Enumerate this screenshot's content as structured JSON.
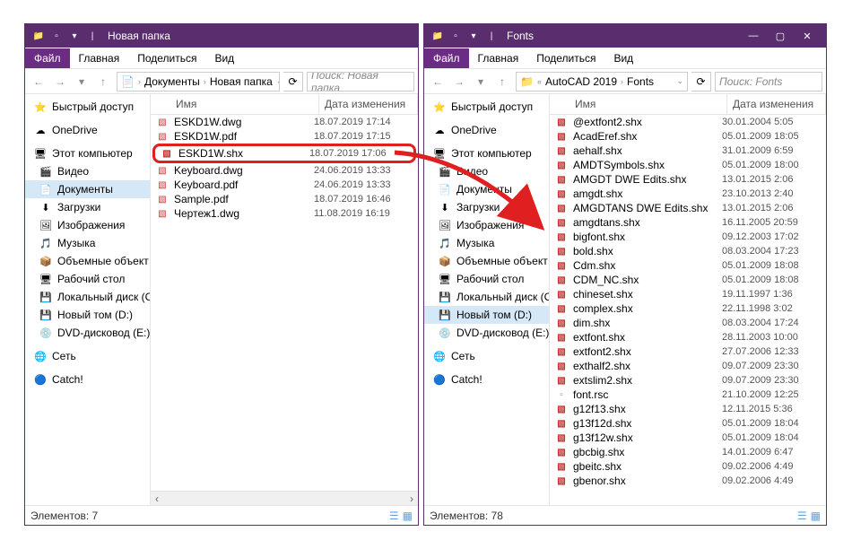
{
  "left": {
    "title": "Новая папка",
    "menu": {
      "file": "Файл",
      "home": "Главная",
      "share": "Поделиться",
      "view": "Вид"
    },
    "breadcrumb": [
      "Документы",
      "Новая папка"
    ],
    "search_placeholder": "Поиск: Новая папка",
    "columns": {
      "name": "Имя",
      "date": "Дата изменения"
    },
    "files": [
      {
        "name": "ESKD1W.dwg",
        "date": "18.07.2019 17:14",
        "icon": "dwg"
      },
      {
        "name": "ESKD1W.pdf",
        "date": "18.07.2019 17:15",
        "icon": "pdf"
      },
      {
        "name": "ESKD1W.shx",
        "date": "18.07.2019 17:06",
        "icon": "shx",
        "highlight": true
      },
      {
        "name": "Keyboard.dwg",
        "date": "24.06.2019 13:33",
        "icon": "dwg"
      },
      {
        "name": "Keyboard.pdf",
        "date": "24.06.2019 13:33",
        "icon": "pdf"
      },
      {
        "name": "Sample.pdf",
        "date": "18.07.2019 16:46",
        "icon": "pdf"
      },
      {
        "name": "Чертеж1.dwg",
        "date": "11.08.2019 16:19",
        "icon": "dwg"
      }
    ],
    "status": "Элементов: 7"
  },
  "right": {
    "title": "Fonts",
    "menu": {
      "file": "Файл",
      "home": "Главная",
      "share": "Поделиться",
      "view": "Вид"
    },
    "breadcrumb": [
      "AutoCAD 2019",
      "Fonts"
    ],
    "search_placeholder": "Поиск: Fonts",
    "columns": {
      "name": "Имя",
      "date": "Дата изменения"
    },
    "files": [
      {
        "name": "@extfont2.shx",
        "date": "30.01.2004 5:05",
        "icon": "shx"
      },
      {
        "name": "AcadEref.shx",
        "date": "05.01.2009 18:05",
        "icon": "shx"
      },
      {
        "name": "aehalf.shx",
        "date": "31.01.2009 6:59",
        "icon": "shx"
      },
      {
        "name": "AMDTSymbols.shx",
        "date": "05.01.2009 18:00",
        "icon": "shx"
      },
      {
        "name": "AMGDT DWE Edits.shx",
        "date": "13.01.2015 2:06",
        "icon": "shx"
      },
      {
        "name": "amgdt.shx",
        "date": "23.10.2013 2:40",
        "icon": "shx"
      },
      {
        "name": "AMGDTANS DWE Edits.shx",
        "date": "13.01.2015 2:06",
        "icon": "shx"
      },
      {
        "name": "amgdtans.shx",
        "date": "16.11.2005 20:59",
        "icon": "shx"
      },
      {
        "name": "bigfont.shx",
        "date": "09.12.2003 17:02",
        "icon": "shx"
      },
      {
        "name": "bold.shx",
        "date": "08.03.2004 17:23",
        "icon": "shx"
      },
      {
        "name": "Cdm.shx",
        "date": "05.01.2009 18:08",
        "icon": "shx"
      },
      {
        "name": "CDM_NC.shx",
        "date": "05.01.2009 18:08",
        "icon": "shx"
      },
      {
        "name": "chineset.shx",
        "date": "19.11.1997 1:36",
        "icon": "shx"
      },
      {
        "name": "complex.shx",
        "date": "22.11.1998 3:02",
        "icon": "shx"
      },
      {
        "name": "dim.shx",
        "date": "08.03.2004 17:24",
        "icon": "shx"
      },
      {
        "name": "extfont.shx",
        "date": "28.11.2003 10:00",
        "icon": "shx"
      },
      {
        "name": "extfont2.shx",
        "date": "27.07.2006 12:33",
        "icon": "shx"
      },
      {
        "name": "exthalf2.shx",
        "date": "09.07.2009 23:30",
        "icon": "shx"
      },
      {
        "name": "extslim2.shx",
        "date": "09.07.2009 23:30",
        "icon": "shx"
      },
      {
        "name": "font.rsc",
        "date": "21.10.2009 12:25",
        "icon": "rsc"
      },
      {
        "name": "g12f13.shx",
        "date": "12.11.2015 5:36",
        "icon": "shx"
      },
      {
        "name": "g13f12d.shx",
        "date": "05.01.2009 18:04",
        "icon": "shx"
      },
      {
        "name": "g13f12w.shx",
        "date": "05.01.2009 18:04",
        "icon": "shx"
      },
      {
        "name": "gbcbig.shx",
        "date": "14.01.2009 6:47",
        "icon": "shx"
      },
      {
        "name": "gbeitc.shx",
        "date": "09.02.2006 4:49",
        "icon": "shx"
      },
      {
        "name": "gbenor.shx",
        "date": "09.02.2006 4:49",
        "icon": "shx"
      }
    ],
    "status": "Элементов: 78"
  },
  "sidebar": {
    "quick": "Быстрый доступ",
    "onedrive": "OneDrive",
    "thispc": "Этот компьютер",
    "items": [
      {
        "label": "Видео",
        "icon": "video"
      },
      {
        "label": "Документы",
        "icon": "docs"
      },
      {
        "label": "Загрузки",
        "icon": "downloads"
      },
      {
        "label": "Изображения",
        "icon": "pictures"
      },
      {
        "label": "Музыка",
        "icon": "music"
      },
      {
        "label": "Объемные объект",
        "icon": "3d"
      },
      {
        "label": "Рабочий стол",
        "icon": "desktop"
      },
      {
        "label": "Локальный диск (C",
        "icon": "disk"
      },
      {
        "label": "Новый том (D:)",
        "icon": "disk"
      },
      {
        "label": "DVD-дисковод (E:)",
        "icon": "dvd"
      }
    ],
    "network": "Сеть",
    "catch": "Catch!"
  }
}
